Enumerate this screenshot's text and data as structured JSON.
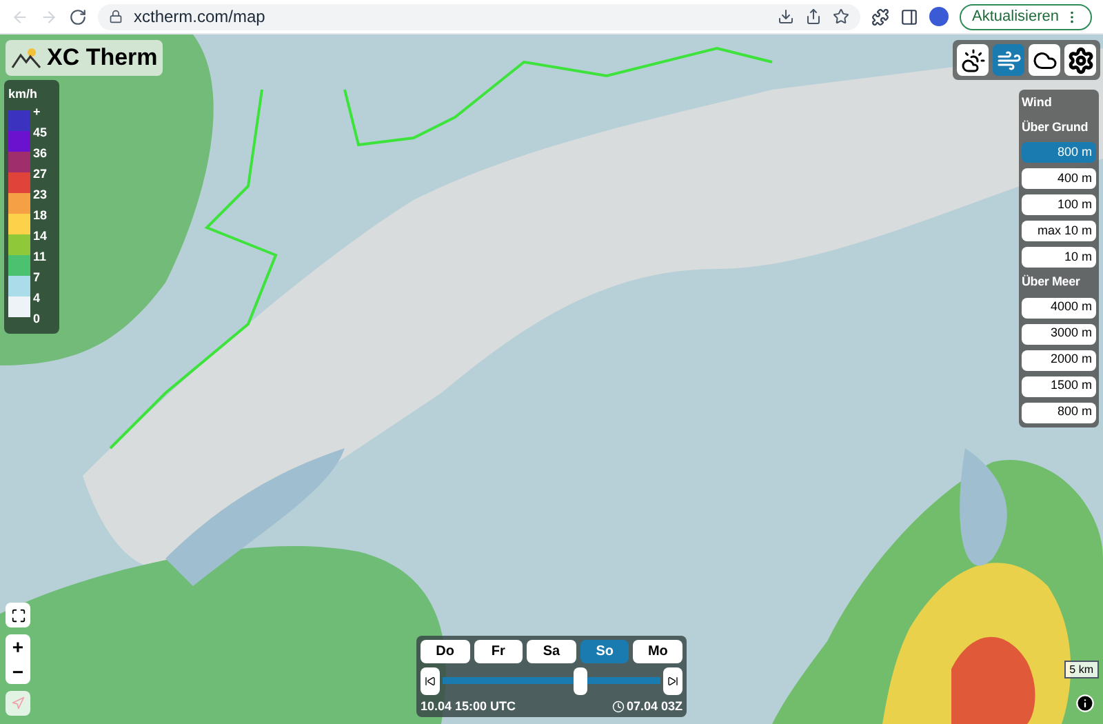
{
  "browser": {
    "url": "xctherm.com/map",
    "update_button": "Aktualisieren"
  },
  "logo": {
    "text": "XC Therm"
  },
  "legend": {
    "unit": "km/h",
    "labels": [
      "+",
      "45",
      "36",
      "27",
      "23",
      "18",
      "14",
      "11",
      "7",
      "4",
      "0"
    ],
    "swatches": [
      {
        "color": "#3b33bf"
      },
      {
        "color": "#6b12cf"
      },
      {
        "color": "#9e2f6c"
      },
      {
        "color": "#e0433a"
      },
      {
        "color": "#f6a045"
      },
      {
        "color": "#fdd24a"
      },
      {
        "color": "#8fc93a"
      },
      {
        "color": "#4cc16f"
      },
      {
        "color": "#abdcea"
      },
      {
        "color": "#eef3f8"
      }
    ]
  },
  "layers": [
    {
      "kind": "cloud",
      "selected": false
    },
    {
      "kind": "wind",
      "selected": true
    },
    {
      "kind": "inversion",
      "selected": false
    },
    {
      "kind": "settings",
      "selected": false
    }
  ],
  "panel": {
    "title": "Wind",
    "sections": [
      {
        "title": "Über Grund",
        "levels": [
          {
            "label": "800 m",
            "selected": true
          },
          {
            "label": "400 m",
            "selected": false
          },
          {
            "label": "100 m",
            "selected": false
          },
          {
            "label": "max 10 m",
            "selected": false
          },
          {
            "label": "10 m",
            "selected": false
          }
        ]
      },
      {
        "title": "Über Meer",
        "levels": [
          {
            "label": "4000 m",
            "selected": false
          },
          {
            "label": "3000 m",
            "selected": false
          },
          {
            "label": "2000 m",
            "selected": false
          },
          {
            "label": "1500 m",
            "selected": false
          },
          {
            "label": "800 m",
            "selected": false
          }
        ]
      }
    ]
  },
  "timeline": {
    "days": [
      {
        "label": "Do",
        "selected": false
      },
      {
        "label": "Fr",
        "selected": false
      },
      {
        "label": "Sa",
        "selected": false
      },
      {
        "label": "So",
        "selected": true
      },
      {
        "label": "Mo",
        "selected": false
      }
    ],
    "level": 0.63,
    "time": "10.04 15:00 UTC",
    "run": "07.04 03Z"
  },
  "zoom": {
    "in": "+",
    "out": "−"
  },
  "compass": {
    "disabled": true
  },
  "scale": "5 km"
}
